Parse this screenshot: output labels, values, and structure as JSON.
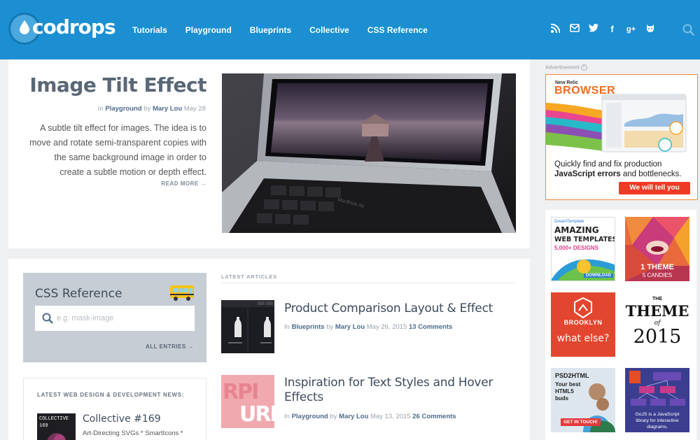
{
  "header": {
    "logo_text": "codrops",
    "nav": [
      "Tutorials",
      "Playground",
      "Blueprints",
      "Collective",
      "CSS Reference"
    ],
    "social_icons": [
      "rss-icon",
      "mail-icon",
      "twitter-icon",
      "facebook-icon",
      "google-plus-icon",
      "github-icon"
    ],
    "brand_color": "#1b8fd1"
  },
  "feature": {
    "title": "Image Tilt Effect",
    "meta_in": "In",
    "meta_category": "Playground",
    "meta_by": "by",
    "meta_author": "Mary Lou",
    "meta_date": "May 28",
    "description": "A subtle tilt effect for images. The idea is to move and rotate semi-transparent copies with the same background image in order to create a subtle motion or depth effect.",
    "read_more": "READ MORE →",
    "laptop_label": "MacBook Air"
  },
  "css_reference": {
    "title": "CSS Reference",
    "placeholder": "e.g. mask-image",
    "all_entries": "ALL ENTRIES →"
  },
  "news": {
    "heading": "LATEST WEB DESIGN & DEVELOPMENT NEWS:",
    "thumb_text": "COLLECTIVE\n169",
    "item_title": "Collective #169",
    "item_sub": "Art-Directing SVGs * SmartIcons *"
  },
  "latest": {
    "label": "LATEST ARTICLES",
    "articles": [
      {
        "title": "Product Comparison Layout & Effect",
        "in": "In",
        "category": "Blueprints",
        "by": "by",
        "author": "Mary Lou",
        "date": "May 26, 2015",
        "comments": "13 Comments"
      },
      {
        "title": "Inspiration for Text Styles and Hover Effects",
        "in": "In",
        "category": "Playground",
        "by": "by",
        "author": "Mary Lou",
        "date": "May 13, 2015",
        "comments": "26 Comments",
        "thumb_text": "RPI URI"
      }
    ]
  },
  "sidebar": {
    "ad_label": "Advertisement",
    "ad_info": "i",
    "newrelic": {
      "brand": "New Relic",
      "title": "BROWSER",
      "text_1": "Quickly find and fix production ",
      "text_2": "JavaScript errors",
      "text_3": " and bottlenecks.",
      "button": "We will tell you"
    },
    "sponsors": [
      {
        "name": "dreamtemplate",
        "l1": "DreamTemplate",
        "l2": "AMAZING",
        "l3": "WEB TEMPLATES",
        "l4": "5,000+ DESIGNS",
        "l5": "DOWNLOAD"
      },
      {
        "name": "candies",
        "l1": "1 THEME",
        "l2": "5 CANDIES"
      },
      {
        "name": "brooklyn",
        "l1": "BROOKLYN",
        "l2": "what else?"
      },
      {
        "name": "theme2015",
        "l1": "THE",
        "l2": "THEME",
        "l3": "of",
        "l4": "2015"
      },
      {
        "name": "psd2html",
        "l1": "PSD2HTML",
        "l2": "Your best",
        "l3": "HTML5",
        "l4": "buds",
        "l5": "GET IN TOUCH!"
      },
      {
        "name": "gojs",
        "l1": "GoJS is a JavaScript",
        "l2": "library for interactive",
        "l3": "diagrams."
      }
    ]
  }
}
